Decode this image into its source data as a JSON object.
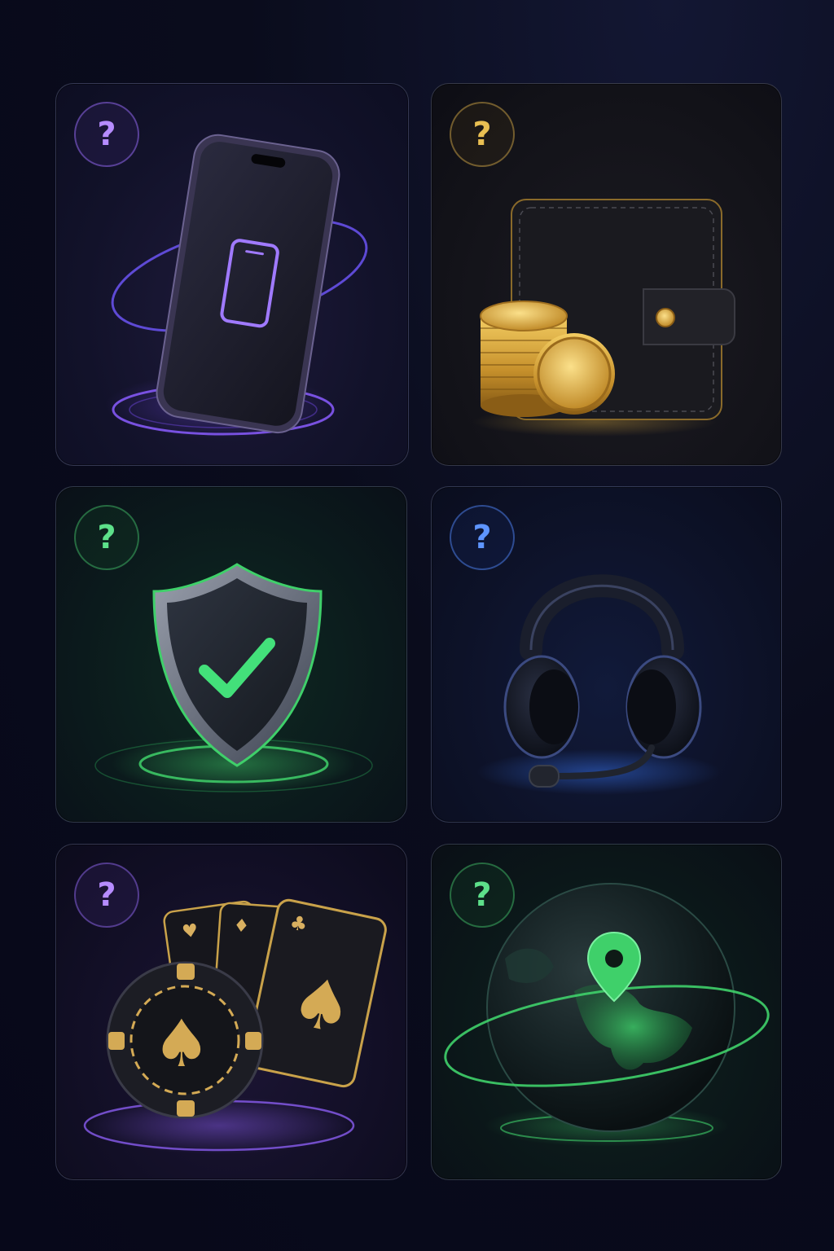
{
  "cards": [
    {
      "name": "phone",
      "question_mark": "?",
      "accent": "#9b6cf0",
      "icon": "smartphone-icon"
    },
    {
      "name": "wallet",
      "question_mark": "?",
      "accent": "#d9a93c",
      "icon": "wallet-coins-icon"
    },
    {
      "name": "shield",
      "question_mark": "?",
      "accent": "#3fd06a",
      "icon": "shield-check-icon"
    },
    {
      "name": "headset",
      "question_mark": "?",
      "accent": "#3b7bff",
      "icon": "headset-icon"
    },
    {
      "name": "cards",
      "question_mark": "?",
      "accent": "#a57af0",
      "icon": "poker-cards-chip-icon"
    },
    {
      "name": "globe",
      "question_mark": "?",
      "accent": "#3fd06a",
      "icon": "globe-location-icon"
    }
  ]
}
